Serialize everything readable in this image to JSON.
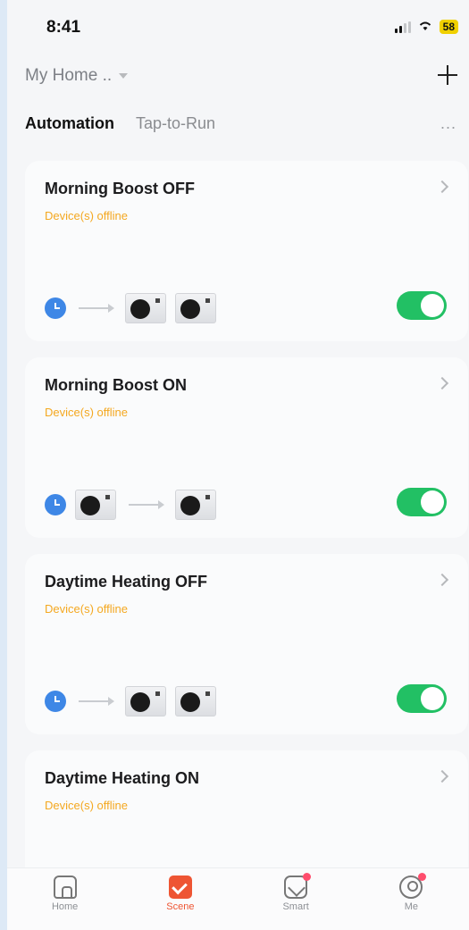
{
  "status_bar": {
    "time": "8:41",
    "battery": "58"
  },
  "header": {
    "home_label": "My Home ..",
    "tabs": [
      {
        "label": "Automation",
        "active": true
      },
      {
        "label": "Tap-to-Run",
        "active": false
      }
    ],
    "more_label": "..."
  },
  "automations": [
    {
      "title": "Morning Boost OFF",
      "status": "Device(s) offline",
      "flow": "clock-to-units",
      "enabled": true
    },
    {
      "title": "Morning Boost ON",
      "status": "Device(s) offline",
      "flow": "clock-unit-to-unit",
      "enabled": true
    },
    {
      "title": "Daytime Heating OFF",
      "status": "Device(s) offline",
      "flow": "clock-to-units",
      "enabled": true
    },
    {
      "title": "Daytime Heating ON",
      "status": "Device(s) offline",
      "flow": "clock-to-units",
      "enabled": true
    }
  ],
  "nav": {
    "items": [
      {
        "label": "Home",
        "icon": "home-icon",
        "active": false
      },
      {
        "label": "Scene",
        "icon": "scene-icon",
        "active": true
      },
      {
        "label": "Smart",
        "icon": "smart-icon",
        "active": false,
        "badge": true
      },
      {
        "label": "Me",
        "icon": "me-icon",
        "active": false,
        "badge": true
      }
    ]
  },
  "colors": {
    "accent": "#ee5533",
    "toggle_on": "#22c064",
    "offline_text": "#f4a820",
    "clock_icon": "#3e87e6"
  }
}
